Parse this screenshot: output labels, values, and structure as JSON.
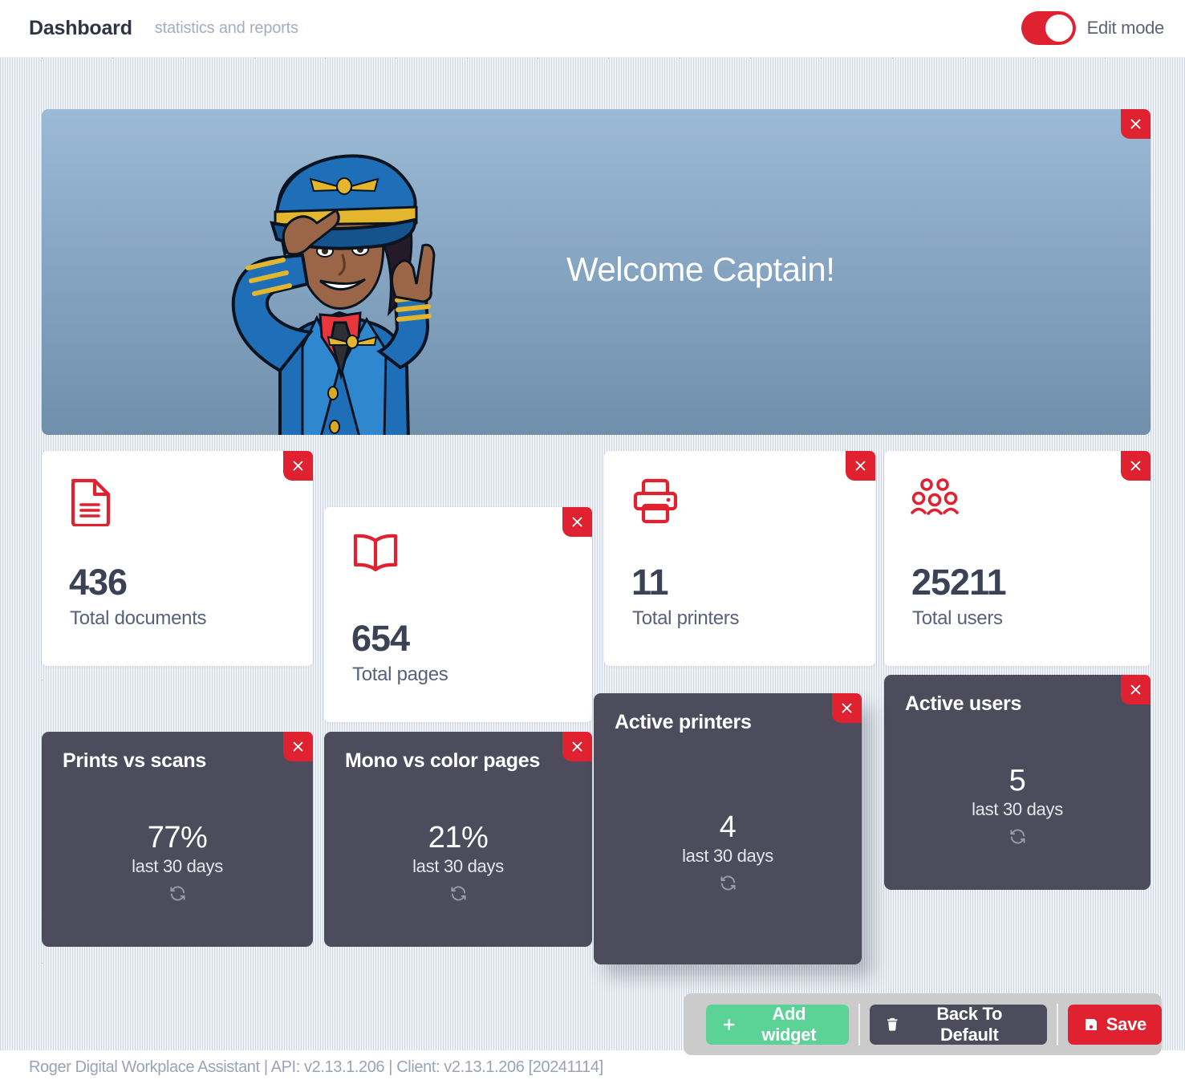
{
  "header": {
    "title": "Dashboard",
    "subtitle": "statistics and reports",
    "edit_mode_label": "Edit mode",
    "edit_mode_on": true,
    "accent_color": "#e02130"
  },
  "hero": {
    "title": "Welcome Captain!",
    "illustration": "pilot-salute-illustration",
    "close_icon": "close-icon",
    "gradient_top": "#9bbad6",
    "gradient_bottom": "#6f8fab"
  },
  "stat_cards": [
    {
      "icon": "document-icon",
      "value": "436",
      "label": "Total documents",
      "close_icon": "close-icon"
    },
    {
      "icon": "book-icon",
      "value": "654",
      "label": "Total pages",
      "close_icon": "close-icon"
    },
    {
      "icon": "printer-icon",
      "value": "11",
      "label": "Total printers",
      "close_icon": "close-icon"
    },
    {
      "icon": "users-icon",
      "value": "25211",
      "label": "Total users",
      "close_icon": "close-icon"
    }
  ],
  "metric_cards": [
    {
      "title": "Prints vs scans",
      "value": "77%",
      "subtitle": "last 30 days",
      "refresh_icon": "refresh-icon",
      "close_icon": "close-icon"
    },
    {
      "title": "Mono vs color pages",
      "value": "21%",
      "subtitle": "last 30 days",
      "refresh_icon": "refresh-icon",
      "close_icon": "close-icon"
    },
    {
      "title": "Active printers",
      "value": "4",
      "subtitle": "last 30 days",
      "refresh_icon": "refresh-icon",
      "close_icon": "close-icon"
    },
    {
      "title": "Active users",
      "value": "5",
      "subtitle": "last 30 days",
      "refresh_icon": "refresh-icon",
      "close_icon": "close-icon"
    }
  ],
  "actions": {
    "add_widget": {
      "label": "Add widget",
      "icon": "plus-icon",
      "color": "#5bd396"
    },
    "back_to_default": {
      "label": "Back To Default",
      "icon": "trash-icon",
      "color": "#4c4c5c"
    },
    "save": {
      "label": "Save",
      "icon": "save-icon",
      "color": "#e02130"
    }
  },
  "footer": {
    "text": "Roger Digital Workplace Assistant | API: v2.13.1.206 | Client: v2.13.1.206 [20241114]"
  }
}
